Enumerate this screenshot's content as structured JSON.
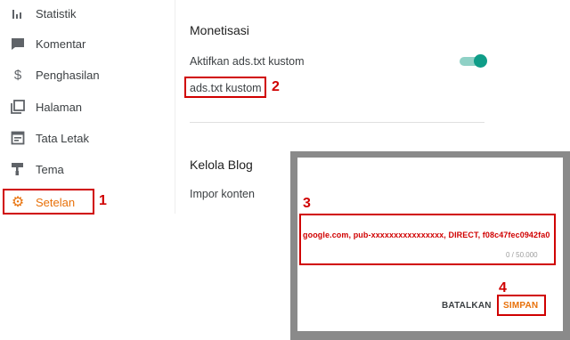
{
  "sidebar": {
    "items": [
      {
        "label": "Statistik",
        "icon": "bar-chart-icon"
      },
      {
        "label": "Komentar",
        "icon": "comment-icon"
      },
      {
        "label": "Penghasilan",
        "icon": "dollar-icon"
      },
      {
        "label": "Halaman",
        "icon": "pages-icon"
      },
      {
        "label": "Tata Letak",
        "icon": "layout-icon"
      },
      {
        "label": "Tema",
        "icon": "paint-roller-icon"
      },
      {
        "label": "Setelan",
        "icon": "gear-icon"
      }
    ],
    "active_color": "#e8710a"
  },
  "monetisasi": {
    "title": "Monetisasi",
    "toggle_label": "Aktifkan ads.txt kustom",
    "toggle_on": true,
    "adstxt_link": "ads.txt kustom"
  },
  "kelola": {
    "title": "Kelola Blog",
    "import_label": "Impor konten"
  },
  "dialog": {
    "value": "google.com, pub-xxxxxxxxxxxxxxxx, DIRECT, f08c47fec0942fa0",
    "counter": "0 / 50.000",
    "cancel_label": "BATALKAN",
    "save_label": "SIMPAN",
    "accent": "#e8710a"
  },
  "annotations": {
    "n1": "1",
    "n2": "2",
    "n3": "3",
    "n4": "4",
    "color": "#d00000"
  }
}
